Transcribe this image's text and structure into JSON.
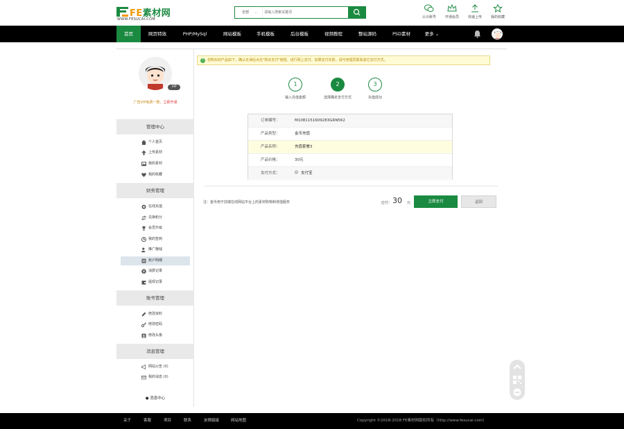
{
  "header": {
    "logo_brand_prefix": "FE",
    "logo_brand_suffix": "素材网",
    "logo_url": "WWW.FESUCAI.COM",
    "search_scope": "全部",
    "search_placeholder": "请输入搜索关键词",
    "quick_links": [
      {
        "label": "公众账号",
        "icon": "wechat-icon"
      },
      {
        "label": "开通会员",
        "icon": "crown-icon"
      },
      {
        "label": "快速上传",
        "icon": "upload-icon"
      },
      {
        "label": "我的收藏",
        "icon": "star-icon"
      }
    ]
  },
  "nav": {
    "items": [
      "首页",
      "网页特效",
      "PHP/MySql",
      "网站模板",
      "手机模板",
      "后台模板",
      "视频教程",
      "整站源码",
      "PSD素材",
      "更多"
    ]
  },
  "sidebar": {
    "vip_badge": "VIP",
    "vip_note": "广告VIP免费一数，",
    "vip_link": "立即开通",
    "sections": [
      {
        "title": "管理中心",
        "items": [
          "个人首页",
          "上传素材",
          "我的素材",
          "我的收藏"
        ]
      },
      {
        "title": "财务管理",
        "items": [
          "在线充值",
          "兑换积分",
          "会员升级",
          "我的签到",
          "推广赚钱",
          "账户明细",
          "消费记录",
          "提现记录"
        ]
      },
      {
        "title": "账号管理",
        "items": [
          "修改资料",
          "修改密码",
          "修改头像"
        ]
      },
      {
        "title": "消息管理",
        "items": [
          "网站公告 (0)",
          "我的消息 (0)"
        ]
      }
    ],
    "active_item": "账户明细",
    "message_center": "消息中心"
  },
  "main": {
    "notice": "您购买的产品如下，确认无误后点击\"购买支付\"按钮，进行网上支付，如果支付失败，请与管理员联系其它支付方式。",
    "steps": [
      {
        "num": "1",
        "label": "输入充值金额"
      },
      {
        "num": "2",
        "label": "选择确定支付方式"
      },
      {
        "num": "3",
        "label": "充值成功"
      }
    ],
    "current_step": 2,
    "order": [
      {
        "key": "订单编号：",
        "value": "M1081151609283GRN562"
      },
      {
        "key": "产品类型：",
        "value": "金币充值"
      },
      {
        "key": "产品名称：",
        "value": "充值套餐3"
      },
      {
        "key": "产品价格：",
        "value": "30元"
      },
      {
        "key": "支付方式：",
        "value": "支付宝"
      }
    ],
    "footnote": "注：金币用于前端在线网站平台上的素材购物和增值服务",
    "pay_label": "应付：",
    "pay_amount": "30",
    "pay_unit": "元",
    "pay_button": "立即支付",
    "back_button": "返回"
  },
  "footer": {
    "links": [
      "关于",
      "客服",
      "项目",
      "联系",
      "友情链接",
      "网站地图"
    ],
    "copyright": "Copyright ©2018-2018 FE素材网版权所有（http://www.fesucai.com）"
  },
  "colors": {
    "brand_green": "#1b8a41",
    "nav_bg": "#000000",
    "notice_bg": "#fffbd5"
  }
}
